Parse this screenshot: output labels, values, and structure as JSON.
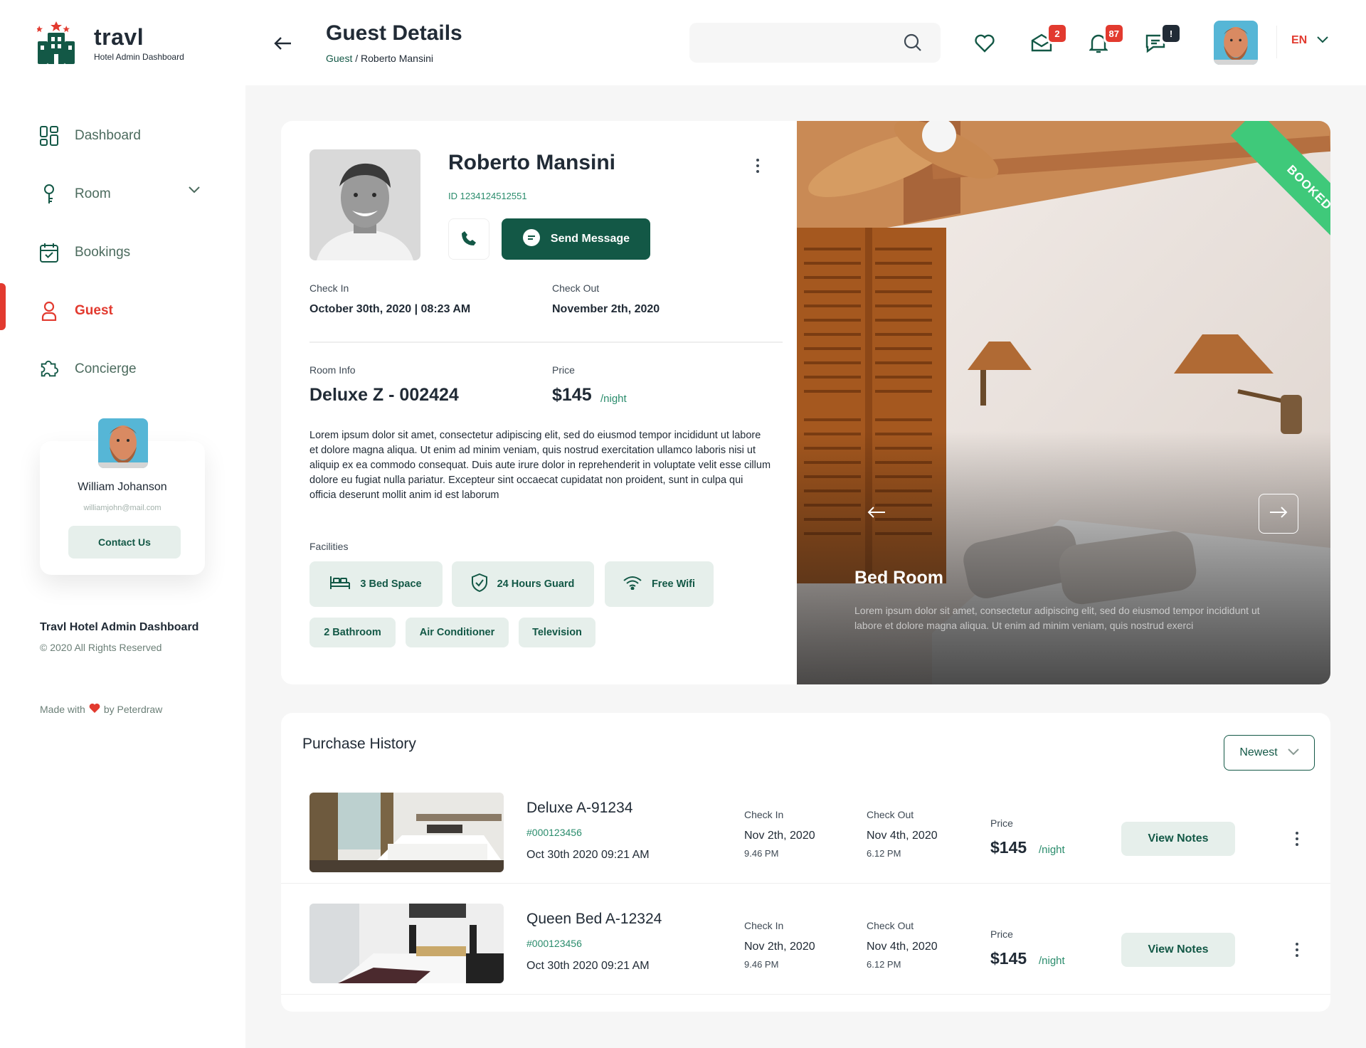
{
  "brand": {
    "name": "travl",
    "subtitle": "Hotel Admin Dashboard"
  },
  "nav": [
    {
      "label": "Dashboard",
      "icon": "dashboard-icon",
      "active": false
    },
    {
      "label": "Room",
      "icon": "key-icon",
      "active": false,
      "has_dropdown": true
    },
    {
      "label": "Bookings",
      "icon": "calendar-icon",
      "active": false
    },
    {
      "label": "Guest",
      "icon": "user-icon",
      "active": true
    },
    {
      "label": "Concierge",
      "icon": "puzzle-icon",
      "active": false
    }
  ],
  "sidebar_profile": {
    "name": "William Johanson",
    "email": "williamjohn@mail.com",
    "button": "Contact Us"
  },
  "sidebar_footer": {
    "title": "Travl Hotel Admin Dashboard",
    "copyright": "© 2020 All Rights Reserved",
    "made_prefix": "Made with",
    "made_suffix": "by Peterdraw"
  },
  "header": {
    "title": "Guest Details",
    "breadcrumb_link": "Guest",
    "breadcrumb_sep": "/",
    "breadcrumb_current": "Roberto Mansini",
    "search_placeholder": "",
    "mail_badge": "2",
    "notif_badge": "87",
    "chat_badge": "!",
    "language": "EN"
  },
  "guest": {
    "name": "Roberto Mansini",
    "id": "ID 1234124512551",
    "send_message": "Send Message",
    "check_in_label": "Check In",
    "check_in": "October 30th, 2020 | 08:23 AM",
    "check_out_label": "Check Out",
    "check_out": "November 2th, 2020",
    "room_info_label": "Room Info",
    "room_info": "Deluxe Z - 002424",
    "price_label": "Price",
    "price": "$145",
    "per_night": "/night",
    "description": "Lorem ipsum dolor sit amet, consectetur adipiscing elit, sed do eiusmod tempor incididunt ut labore et dolore magna aliqua. Ut enim ad minim veniam, quis nostrud exercitation ullamco laboris nisi ut aliquip ex ea commodo consequat. Duis aute irure dolor in reprehenderit in voluptate velit esse cillum dolore eu fugiat nulla pariatur. Excepteur sint occaecat cupidatat non proident, sunt in culpa qui officia deserunt mollit anim id est laborum",
    "facilities_label": "Facilities",
    "facilities": [
      "3 Bed Space",
      "24 Hours Guard",
      "Free Wifi",
      "2 Bathroom",
      "Air Conditioner",
      "Television"
    ]
  },
  "room_photo": {
    "status": "BOOKED",
    "title": "Bed Room",
    "description": "Lorem ipsum dolor sit amet, consectetur adipiscing elit, sed do eiusmod tempor incididunt ut labore et dolore magna aliqua. Ut enim ad minim veniam, quis nostrud exerci"
  },
  "history": {
    "title": "Purchase History",
    "sort": "Newest",
    "check_in_label": "Check In",
    "check_out_label": "Check Out",
    "price_label": "Price",
    "per_night": "/night",
    "notes_button": "View Notes",
    "rows": [
      {
        "room": "Deluxe A-91234",
        "code": "#000123456",
        "date": "Oct 30th 2020 09:21 AM",
        "check_in": "Nov 2th, 2020",
        "check_in_time": "9.46 PM",
        "check_out": "Nov 4th, 2020",
        "check_out_time": "6.12 PM",
        "price": "$145"
      },
      {
        "room": "Queen Bed A-12324",
        "code": "#000123456",
        "date": "Oct 30th 2020 09:21 AM",
        "check_in": "Nov 2th, 2020",
        "check_in_time": "9.46 PM",
        "check_out": "Nov 4th, 2020",
        "check_out_time": "6.12 PM",
        "price": "$145"
      }
    ]
  },
  "colors": {
    "primary": "#135846",
    "accent_red": "#e23a2f",
    "booked_green": "#3fc97a",
    "chip_bg": "#e6efeb",
    "page_bg": "#f6f6f6"
  }
}
